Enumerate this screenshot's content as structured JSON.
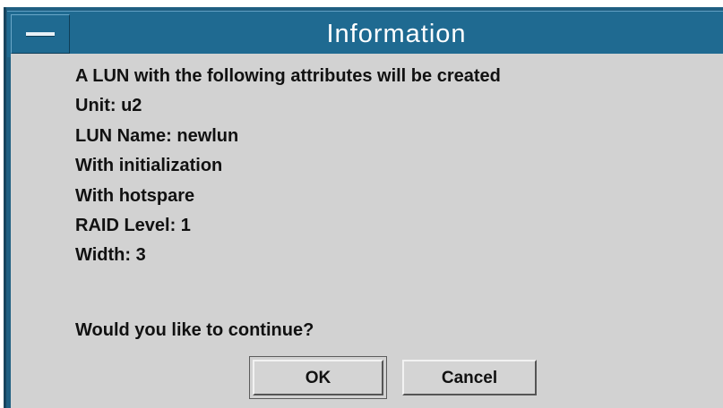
{
  "dialog": {
    "title": "Information",
    "lines": [
      "A LUN with the following attributes will be created",
      "Unit: u2",
      "LUN Name: newlun",
      "With initialization",
      "With hotspare",
      "RAID Level: 1",
      "Width: 3"
    ],
    "question": "Would you like to continue?",
    "buttons": {
      "ok_label": "OK",
      "cancel_label": "Cancel"
    }
  },
  "colors": {
    "titlebar": "#1f6a91",
    "window_frame": "#1f5f82",
    "client_background": "#d2d2d2",
    "text": "#111111",
    "title_text": "#ffffff"
  },
  "icons": {
    "window_menu": "window-menu-icon"
  }
}
